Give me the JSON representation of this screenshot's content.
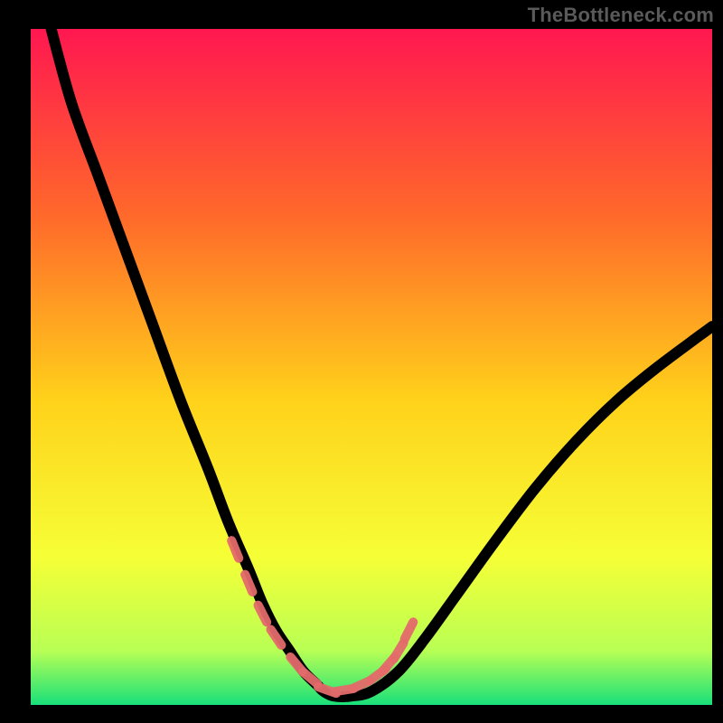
{
  "watermark_text": "TheBottleneck.com",
  "colors": {
    "frame_bg": "#000000",
    "watermark": "#5a5a5a",
    "gradient_top": "#ff1750",
    "gradient_upper_mid": "#ff6a2a",
    "gradient_mid": "#ffd21a",
    "gradient_lower_mid": "#f6ff36",
    "gradient_low": "#b8ff54",
    "gradient_bottom": "#18e07a",
    "curve_stroke": "#000000",
    "marker_stroke": "#e46a6a"
  },
  "chart_data": {
    "type": "line",
    "title": "",
    "xlabel": "",
    "ylabel": "",
    "xlim": [
      0,
      100
    ],
    "ylim": [
      0,
      100
    ],
    "series": [
      {
        "name": "bottleneck-curve",
        "x": [
          3,
          6,
          10,
          14,
          18,
          22,
          26,
          29,
          32,
          34,
          36,
          38,
          40,
          42,
          43,
          44.5,
          47,
          50,
          54,
          58,
          63,
          68,
          74,
          80,
          86,
          92,
          100
        ],
        "y": [
          100,
          89,
          78,
          67,
          56,
          45,
          35,
          27,
          20,
          15,
          11,
          8,
          5,
          3,
          2,
          1.3,
          1.3,
          2,
          5,
          10,
          17,
          24,
          32,
          39,
          45,
          50,
          56
        ]
      }
    ],
    "highlighted_points": {
      "name": "optimal-range-markers",
      "x": [
        30,
        32,
        34,
        36,
        39,
        41,
        43.5,
        46,
        48.5,
        51,
        52.5,
        54,
        55.5
      ],
      "y": [
        23,
        18,
        13.5,
        10,
        6,
        4,
        2.2,
        2.2,
        3,
        4.5,
        6,
        8,
        11
      ]
    },
    "notes": "Values estimated from pixel positions; the plot has no visible axis ticks or numeric labels. x and y are normalized 0–100 across the gradient plot area (origin bottom-left). Curve descends steeply from top-left, reaches minimum near x≈45, then rises more gently toward the right edge to about y≈56. Salmon-colored rounded segments mark the low region of the curve roughly over x∈[30,56]."
  }
}
